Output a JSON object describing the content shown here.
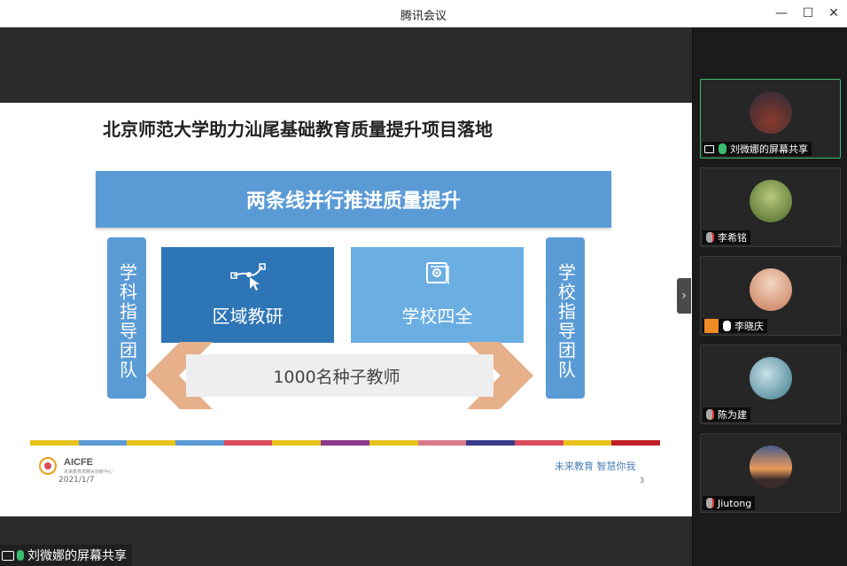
{
  "window": {
    "title": "腾讯会议",
    "minimize": "—",
    "maximize": "☐",
    "close": "✕"
  },
  "slide": {
    "title": "北京师范大学助力汕尾基础教育质量提升项目落地",
    "banner": "两条线并行推进质量提升",
    "left_vertical": "学科指导团队",
    "right_vertical": "学校指导团队",
    "box_left": "区域教研",
    "box_right": "学校四全",
    "arrow_text": "1000名种子教师",
    "logo_text": "AICFE",
    "logo_sub": "未来教育高精尖创新中心",
    "date": "2021/1/7",
    "slogan": "未来教育   智慧你我",
    "page_number": "3",
    "colors": {
      "banner": "#5b9bd5",
      "box_left": "#2e75b6",
      "box_right": "#6aaee2",
      "arrow": "#e6b08a"
    },
    "color_bar": [
      "#e8c31c",
      "#5b9bd5",
      "#e8c31c",
      "#5b9bd5",
      "#d94b5a",
      "#e8c31c",
      "#8a3a8a",
      "#e8c31c",
      "#d97a8a",
      "#3a3a8a",
      "#d94b5a",
      "#e8c31c",
      "#c0202a"
    ]
  },
  "share_label": "刘微娜的屏幕共享",
  "participants": [
    {
      "name": "刘微娜的屏幕共享",
      "mic": "on",
      "sharing": true,
      "active": true,
      "avatar_color": "#5a3a3a"
    },
    {
      "name": "李希铭",
      "mic": "muted",
      "sharing": false,
      "active": false,
      "avatar_color": "#6b8c3a"
    },
    {
      "name": "李晓庆",
      "mic": "on",
      "sharing": false,
      "active": false,
      "avatar_color": "#d9c0a8",
      "host_badge": true
    },
    {
      "name": "陈为建",
      "mic": "muted",
      "sharing": false,
      "active": false,
      "avatar_color": "#4a8a9a"
    },
    {
      "name": "Jiutong",
      "mic": "muted",
      "sharing": false,
      "active": false,
      "avatar_color": "#c46a3a"
    }
  ]
}
